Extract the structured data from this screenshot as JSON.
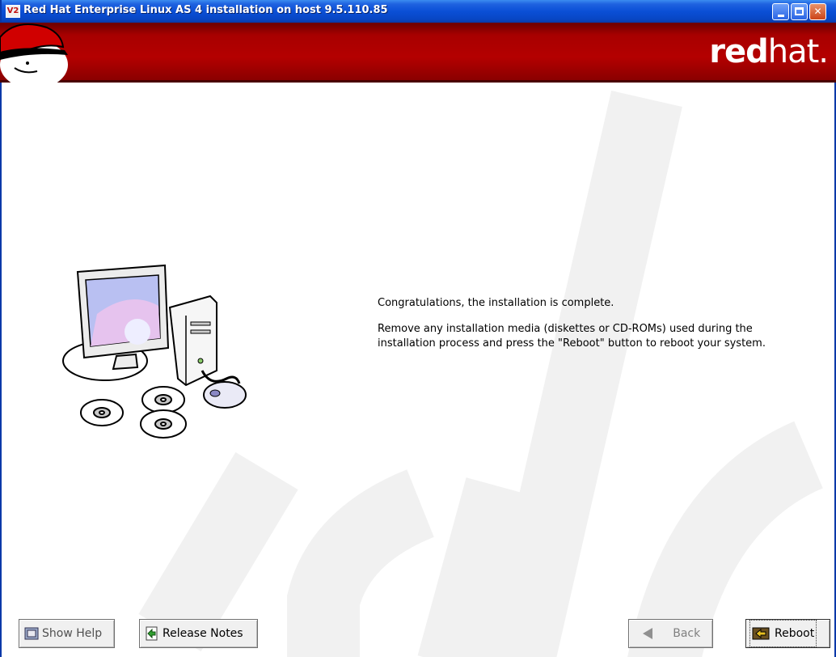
{
  "window": {
    "icon_text": "V2",
    "title": "Red Hat Enterprise Linux AS 4 installation on host 9.5.110.85"
  },
  "banner": {
    "brand_bold": "red",
    "brand_light": "hat.",
    "color": "#b40000"
  },
  "main": {
    "message_line1": "Congratulations, the installation is complete.",
    "message_line2": "Remove any installation media (diskettes or CD-ROMs) used during the installation process and press the \"Reboot\" button to reboot your system."
  },
  "buttons": {
    "show_help": "Show Help",
    "release_notes": "Release Notes",
    "back": "Back",
    "reboot": "Reboot"
  },
  "icons": {
    "show_help_icon": "help-book-icon",
    "release_notes_icon": "notes-arrow-icon",
    "back_icon": "left-arrow-icon",
    "reboot_icon": "reboot-icon",
    "illustration": "computer-with-cds-illustration"
  }
}
